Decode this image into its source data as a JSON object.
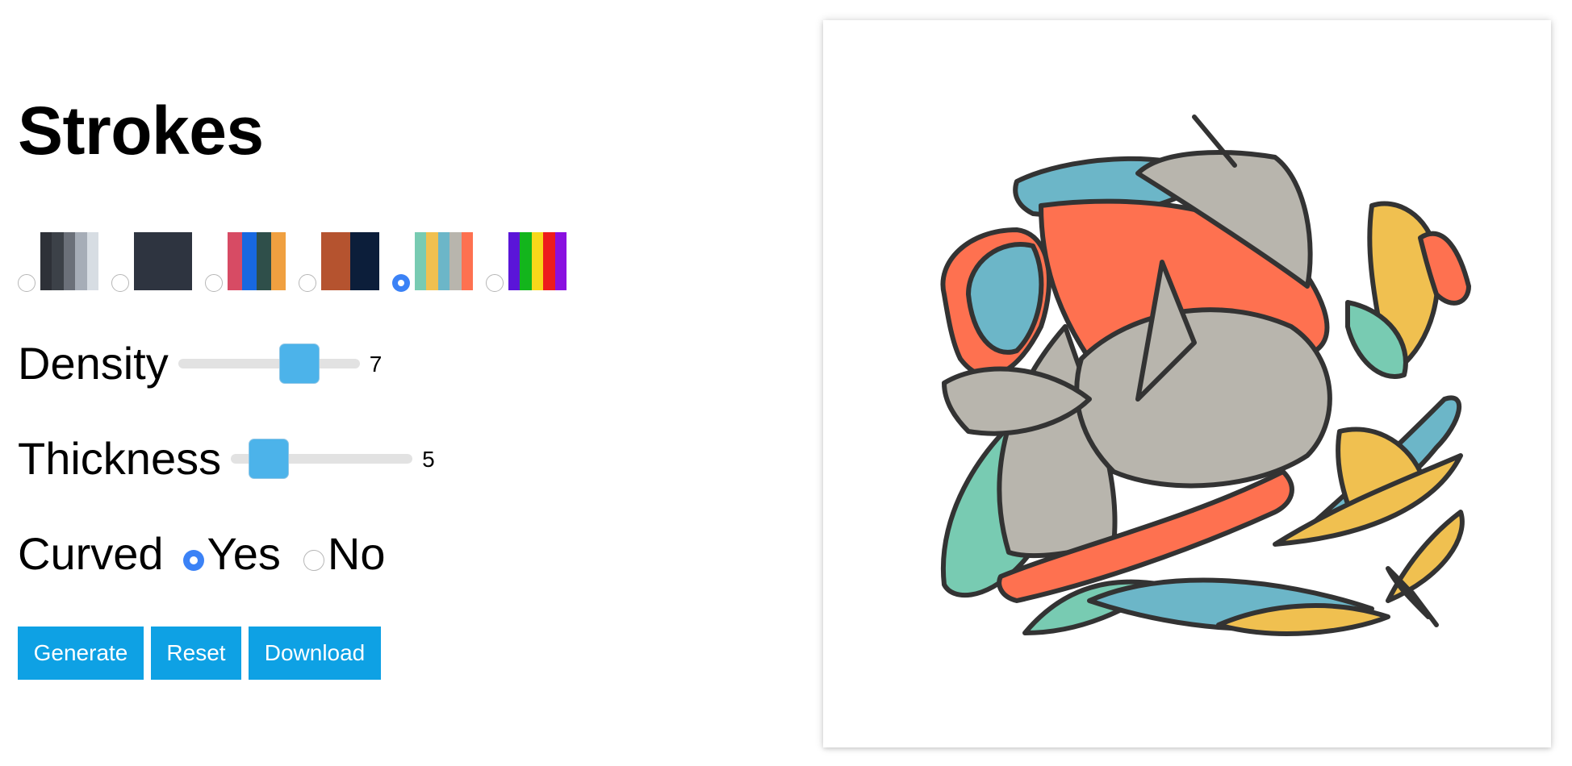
{
  "title": "Strokes",
  "palettes": [
    {
      "id": "grays",
      "selected": false,
      "colors": [
        "#2e3138",
        "#3c4148",
        "#6b7079",
        "#a6adb7",
        "#d7dde3"
      ]
    },
    {
      "id": "dark",
      "selected": false,
      "colors": [
        "#2e3440"
      ]
    },
    {
      "id": "mixed",
      "selected": false,
      "colors": [
        "#d74b64",
        "#1868e0",
        "#2f4f4a",
        "#f0a040"
      ]
    },
    {
      "id": "rust-navy",
      "selected": false,
      "colors": [
        "#b5532f",
        "#0c1e3a"
      ]
    },
    {
      "id": "pastel",
      "selected": true,
      "colors": [
        "#78cbb2",
        "#f0c050",
        "#6cb6c8",
        "#b8b5ad",
        "#fe7150"
      ]
    },
    {
      "id": "rainbow",
      "selected": false,
      "colors": [
        "#5a15d8",
        "#13b51c",
        "#f8d81a",
        "#ed1c1c",
        "#8a10e0"
      ]
    }
  ],
  "density": {
    "label": "Density",
    "value": 7,
    "min": 1,
    "max": 10
  },
  "thickness": {
    "label": "Thickness",
    "value": 5,
    "min": 1,
    "max": 20
  },
  "curved": {
    "label": "Curved",
    "yes_label": "Yes",
    "no_label": "No",
    "selected": "Yes"
  },
  "buttons": {
    "generate": "Generate",
    "reset": "Reset",
    "download": "Download"
  },
  "colors": {
    "accent": "#0ea1e4",
    "slider_thumb": "#4cb3ea",
    "radio_checked": "#3b82f6",
    "stroke": "#333333"
  }
}
